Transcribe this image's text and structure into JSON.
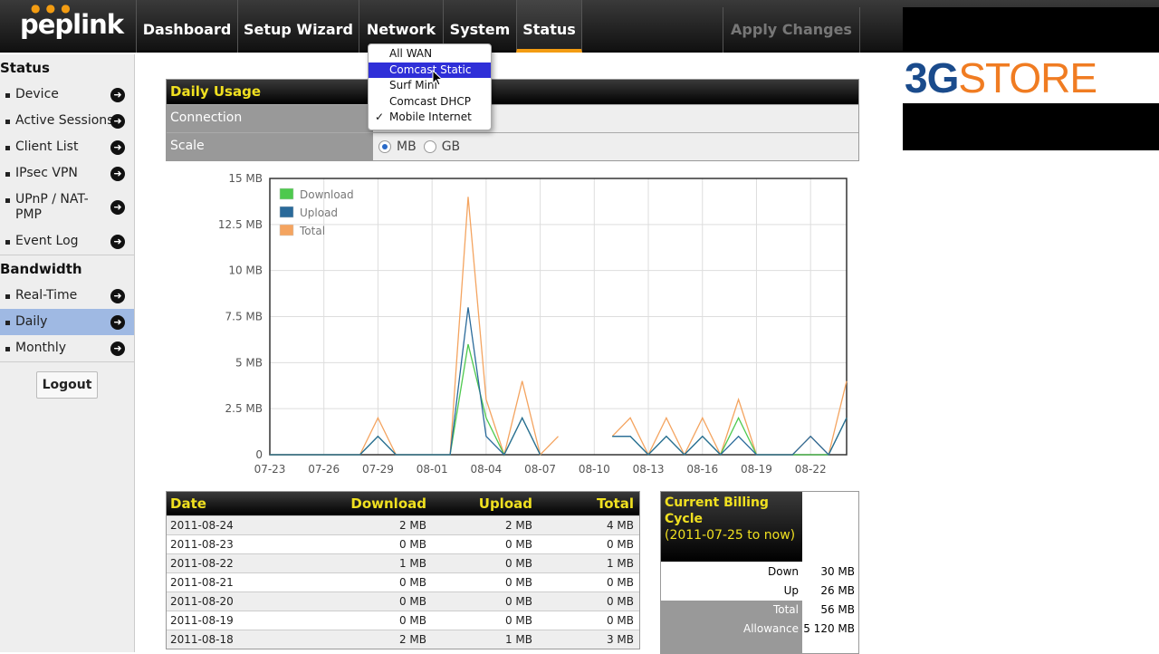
{
  "logo": {
    "text": "peplink"
  },
  "nav": {
    "items": [
      "Dashboard",
      "Setup Wizard",
      "Network",
      "System",
      "Status"
    ],
    "active": "Status",
    "apply": "Apply Changes"
  },
  "brand": {
    "part1": "3G",
    "part2": "STORE"
  },
  "sidebar": {
    "status_heading": "Status",
    "status_items": [
      "Device",
      "Active Sessions",
      "Client List",
      "IPsec VPN",
      "UPnP / NAT-PMP",
      "Event Log"
    ],
    "bandwidth_heading": "Bandwidth",
    "bandwidth_items": [
      "Real-Time",
      "Daily",
      "Monthly"
    ],
    "selected": "Daily",
    "logout": "Logout"
  },
  "usage": {
    "title": "Daily Usage",
    "connection_label": "Connection",
    "scale_label": "Scale",
    "scale_options": [
      "MB",
      "GB"
    ],
    "scale_selected": "MB"
  },
  "dropdown": {
    "options": [
      "All WAN",
      "Comcast Static",
      "Surf Mini",
      "Comcast DHCP",
      "Mobile Internet"
    ],
    "highlighted": "Comcast Static",
    "checked": "Mobile Internet"
  },
  "chart_data": {
    "type": "line",
    "x": [
      "07-23",
      "07-24",
      "07-25",
      "07-26",
      "07-27",
      "07-28",
      "07-29",
      "07-30",
      "07-31",
      "08-01",
      "08-02",
      "08-03",
      "08-04",
      "08-05",
      "08-06",
      "08-07",
      "08-08",
      "08-09",
      "08-10",
      "08-11",
      "08-12",
      "08-13",
      "08-14",
      "08-15",
      "08-16",
      "08-17",
      "08-18",
      "08-19",
      "08-20",
      "08-21",
      "08-22",
      "08-23",
      "08-24"
    ],
    "xticks": [
      "07-23",
      "07-26",
      "07-29",
      "08-01",
      "08-04",
      "08-07",
      "08-10",
      "08-13",
      "08-16",
      "08-19",
      "08-22"
    ],
    "yticks": [
      "0",
      "2.5 MB",
      "5 MB",
      "7.5 MB",
      "10 MB",
      "12.5 MB",
      "15 MB"
    ],
    "ylim": [
      0,
      15
    ],
    "legend_position": "top-left",
    "series": [
      {
        "name": "Download",
        "color": "#4ec94e",
        "values": [
          0,
          0,
          0,
          0,
          0,
          0,
          1,
          0,
          0,
          0,
          0,
          6,
          2,
          0,
          2,
          0,
          null,
          null,
          null,
          1,
          1,
          0,
          1,
          0,
          1,
          0,
          2,
          0,
          0,
          0,
          0,
          0,
          2
        ]
      },
      {
        "name": "Upload",
        "color": "#2a6a9a",
        "values": [
          0,
          0,
          0,
          0,
          0,
          0,
          1,
          0,
          0,
          0,
          0,
          8,
          1,
          0,
          2,
          0,
          null,
          null,
          null,
          1,
          1,
          0,
          1,
          0,
          1,
          0,
          1,
          0,
          0,
          0,
          1,
          0,
          2
        ]
      },
      {
        "name": "Total",
        "color": "#f4a460",
        "values": [
          0,
          0,
          0,
          0,
          0,
          0,
          2,
          0,
          0,
          0,
          0,
          14,
          3,
          0,
          4,
          0,
          1,
          null,
          null,
          1,
          2,
          0,
          2,
          0,
          2,
          0,
          3,
          0,
          0,
          0,
          1,
          0,
          4
        ]
      }
    ]
  },
  "daily_table": {
    "headers": [
      "Date",
      "Download",
      "Upload",
      "Total"
    ],
    "rows": [
      [
        "2011-08-24",
        "2 MB",
        "2 MB",
        "4 MB"
      ],
      [
        "2011-08-23",
        "0 MB",
        "0 MB",
        "0 MB"
      ],
      [
        "2011-08-22",
        "1 MB",
        "0 MB",
        "1 MB"
      ],
      [
        "2011-08-21",
        "0 MB",
        "0 MB",
        "0 MB"
      ],
      [
        "2011-08-20",
        "0 MB",
        "0 MB",
        "0 MB"
      ],
      [
        "2011-08-19",
        "0 MB",
        "0 MB",
        "0 MB"
      ],
      [
        "2011-08-18",
        "2 MB",
        "1 MB",
        "3 MB"
      ]
    ]
  },
  "billing": {
    "title": "Current Billing Cycle",
    "period": "(2011-07-25 to now)",
    "rows": [
      {
        "label": "Down",
        "value": "30 MB"
      },
      {
        "label": "Up",
        "value": "26 MB"
      },
      {
        "label": "Total",
        "value": "56 MB"
      },
      {
        "label": "Allowance",
        "value": "5 120 MB"
      }
    ]
  }
}
